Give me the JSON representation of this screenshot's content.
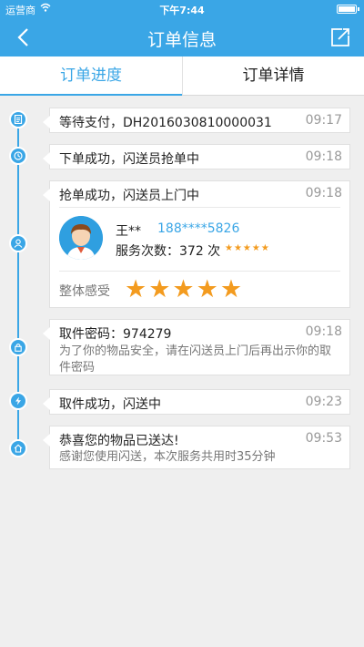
{
  "status_bar": {
    "carrier": "运营商",
    "time": "下午7:44"
  },
  "nav": {
    "title": "订单信息",
    "back_icon": "chevron-left-icon",
    "share_icon": "share-icon"
  },
  "tabs": [
    {
      "label": "订单进度",
      "active": true
    },
    {
      "label": "订单详情",
      "active": false
    }
  ],
  "timeline": [
    {
      "icon": "document-icon",
      "title": "等待支付，DH2016030810000031",
      "time": "09:17"
    },
    {
      "icon": "clock-icon",
      "title": "下单成功，闪送员抢单中",
      "time": "09:18"
    },
    {
      "icon": "user-icon",
      "title": "抢单成功，闪送员上门中",
      "time": "09:18",
      "courier": {
        "name": "王**",
        "phone": "188****5826",
        "service_count_label": "服务次数：",
        "service_count_value": "372 次",
        "small_stars": "★★★★★",
        "rating_label": "整体感受",
        "rating_stars": "★★★★★",
        "rating": 5
      }
    },
    {
      "icon": "lock-icon",
      "title": "取件密码：974279",
      "time": "09:18",
      "detail": "为了你的物品安全，请在闪送员上门后再出示你的取件密码"
    },
    {
      "icon": "lightning-icon",
      "title": "取件成功，闪送中",
      "time": "09:23"
    },
    {
      "icon": "home-icon",
      "title": "恭喜您的物品已送达!",
      "time": "09:53",
      "detail": "感谢您使用闪送，本次服务共用时35分钟"
    }
  ],
  "colors": {
    "accent": "#3aa6e6",
    "star": "#f39b1f",
    "background": "#efefef"
  }
}
